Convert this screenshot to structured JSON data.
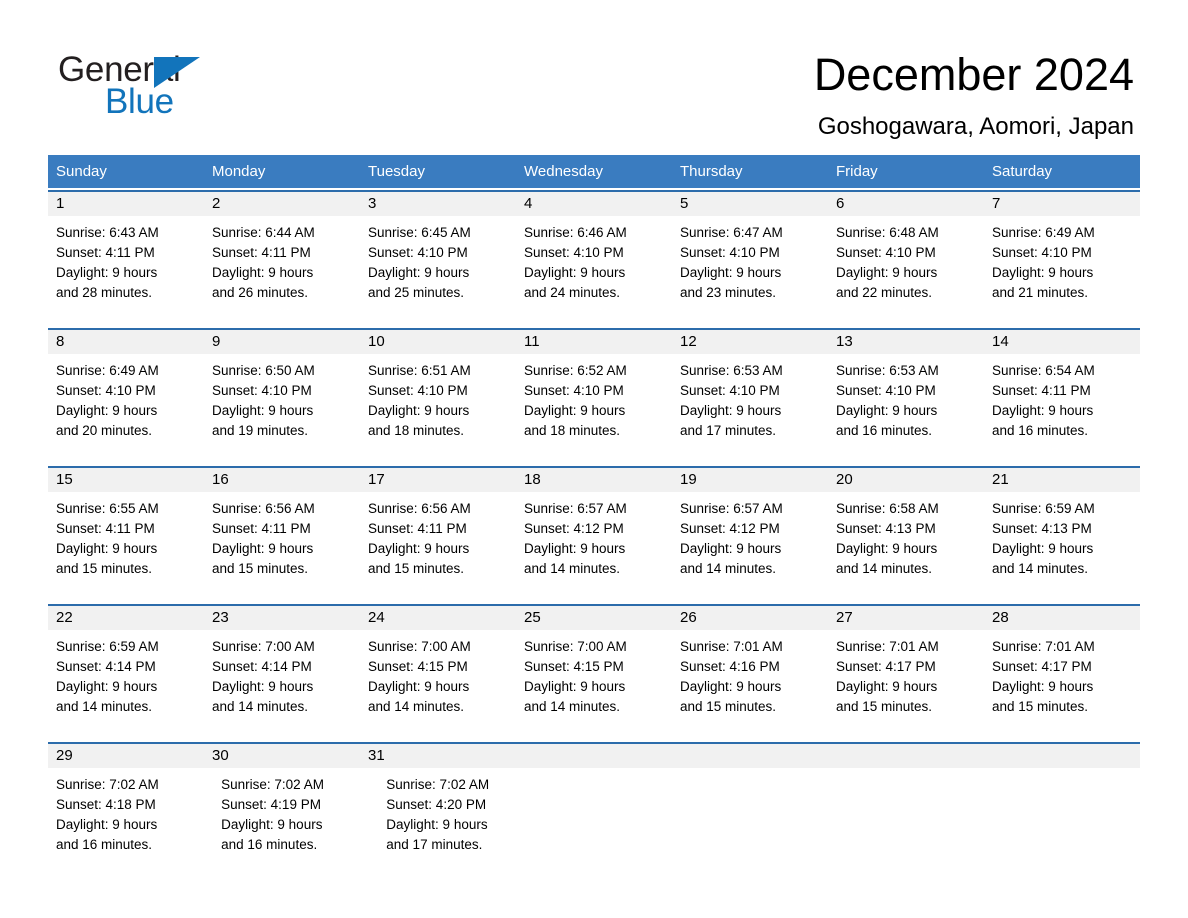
{
  "brand": {
    "name_part1": "General",
    "name_part2": "Blue",
    "triangle_color": "#1274bb",
    "text_color": "#231f20"
  },
  "header": {
    "title": "December 2024",
    "location": "Goshogawara, Aomori, Japan",
    "accent_color": "#3a7cc0",
    "rule_color": "#2c6cab",
    "daynum_bg": "#f1f1f1"
  },
  "weekdays": [
    "Sunday",
    "Monday",
    "Tuesday",
    "Wednesday",
    "Thursday",
    "Friday",
    "Saturday"
  ],
  "weeks": [
    {
      "days": [
        {
          "num": "1",
          "sunrise": "Sunrise: 6:43 AM",
          "sunset": "Sunset: 4:11 PM",
          "daylight_line1": "Daylight: 9 hours",
          "daylight_line2": "and 28 minutes."
        },
        {
          "num": "2",
          "sunrise": "Sunrise: 6:44 AM",
          "sunset": "Sunset: 4:11 PM",
          "daylight_line1": "Daylight: 9 hours",
          "daylight_line2": "and 26 minutes."
        },
        {
          "num": "3",
          "sunrise": "Sunrise: 6:45 AM",
          "sunset": "Sunset: 4:10 PM",
          "daylight_line1": "Daylight: 9 hours",
          "daylight_line2": "and 25 minutes."
        },
        {
          "num": "4",
          "sunrise": "Sunrise: 6:46 AM",
          "sunset": "Sunset: 4:10 PM",
          "daylight_line1": "Daylight: 9 hours",
          "daylight_line2": "and 24 minutes."
        },
        {
          "num": "5",
          "sunrise": "Sunrise: 6:47 AM",
          "sunset": "Sunset: 4:10 PM",
          "daylight_line1": "Daylight: 9 hours",
          "daylight_line2": "and 23 minutes."
        },
        {
          "num": "6",
          "sunrise": "Sunrise: 6:48 AM",
          "sunset": "Sunset: 4:10 PM",
          "daylight_line1": "Daylight: 9 hours",
          "daylight_line2": "and 22 minutes."
        },
        {
          "num": "7",
          "sunrise": "Sunrise: 6:49 AM",
          "sunset": "Sunset: 4:10 PM",
          "daylight_line1": "Daylight: 9 hours",
          "daylight_line2": "and 21 minutes."
        }
      ]
    },
    {
      "days": [
        {
          "num": "8",
          "sunrise": "Sunrise: 6:49 AM",
          "sunset": "Sunset: 4:10 PM",
          "daylight_line1": "Daylight: 9 hours",
          "daylight_line2": "and 20 minutes."
        },
        {
          "num": "9",
          "sunrise": "Sunrise: 6:50 AM",
          "sunset": "Sunset: 4:10 PM",
          "daylight_line1": "Daylight: 9 hours",
          "daylight_line2": "and 19 minutes."
        },
        {
          "num": "10",
          "sunrise": "Sunrise: 6:51 AM",
          "sunset": "Sunset: 4:10 PM",
          "daylight_line1": "Daylight: 9 hours",
          "daylight_line2": "and 18 minutes."
        },
        {
          "num": "11",
          "sunrise": "Sunrise: 6:52 AM",
          "sunset": "Sunset: 4:10 PM",
          "daylight_line1": "Daylight: 9 hours",
          "daylight_line2": "and 18 minutes."
        },
        {
          "num": "12",
          "sunrise": "Sunrise: 6:53 AM",
          "sunset": "Sunset: 4:10 PM",
          "daylight_line1": "Daylight: 9 hours",
          "daylight_line2": "and 17 minutes."
        },
        {
          "num": "13",
          "sunrise": "Sunrise: 6:53 AM",
          "sunset": "Sunset: 4:10 PM",
          "daylight_line1": "Daylight: 9 hours",
          "daylight_line2": "and 16 minutes."
        },
        {
          "num": "14",
          "sunrise": "Sunrise: 6:54 AM",
          "sunset": "Sunset: 4:11 PM",
          "daylight_line1": "Daylight: 9 hours",
          "daylight_line2": "and 16 minutes."
        }
      ]
    },
    {
      "days": [
        {
          "num": "15",
          "sunrise": "Sunrise: 6:55 AM",
          "sunset": "Sunset: 4:11 PM",
          "daylight_line1": "Daylight: 9 hours",
          "daylight_line2": "and 15 minutes."
        },
        {
          "num": "16",
          "sunrise": "Sunrise: 6:56 AM",
          "sunset": "Sunset: 4:11 PM",
          "daylight_line1": "Daylight: 9 hours",
          "daylight_line2": "and 15 minutes."
        },
        {
          "num": "17",
          "sunrise": "Sunrise: 6:56 AM",
          "sunset": "Sunset: 4:11 PM",
          "daylight_line1": "Daylight: 9 hours",
          "daylight_line2": "and 15 minutes."
        },
        {
          "num": "18",
          "sunrise": "Sunrise: 6:57 AM",
          "sunset": "Sunset: 4:12 PM",
          "daylight_line1": "Daylight: 9 hours",
          "daylight_line2": "and 14 minutes."
        },
        {
          "num": "19",
          "sunrise": "Sunrise: 6:57 AM",
          "sunset": "Sunset: 4:12 PM",
          "daylight_line1": "Daylight: 9 hours",
          "daylight_line2": "and 14 minutes."
        },
        {
          "num": "20",
          "sunrise": "Sunrise: 6:58 AM",
          "sunset": "Sunset: 4:13 PM",
          "daylight_line1": "Daylight: 9 hours",
          "daylight_line2": "and 14 minutes."
        },
        {
          "num": "21",
          "sunrise": "Sunrise: 6:59 AM",
          "sunset": "Sunset: 4:13 PM",
          "daylight_line1": "Daylight: 9 hours",
          "daylight_line2": "and 14 minutes."
        }
      ]
    },
    {
      "days": [
        {
          "num": "22",
          "sunrise": "Sunrise: 6:59 AM",
          "sunset": "Sunset: 4:14 PM",
          "daylight_line1": "Daylight: 9 hours",
          "daylight_line2": "and 14 minutes."
        },
        {
          "num": "23",
          "sunrise": "Sunrise: 7:00 AM",
          "sunset": "Sunset: 4:14 PM",
          "daylight_line1": "Daylight: 9 hours",
          "daylight_line2": "and 14 minutes."
        },
        {
          "num": "24",
          "sunrise": "Sunrise: 7:00 AM",
          "sunset": "Sunset: 4:15 PM",
          "daylight_line1": "Daylight: 9 hours",
          "daylight_line2": "and 14 minutes."
        },
        {
          "num": "25",
          "sunrise": "Sunrise: 7:00 AM",
          "sunset": "Sunset: 4:15 PM",
          "daylight_line1": "Daylight: 9 hours",
          "daylight_line2": "and 14 minutes."
        },
        {
          "num": "26",
          "sunrise": "Sunrise: 7:01 AM",
          "sunset": "Sunset: 4:16 PM",
          "daylight_line1": "Daylight: 9 hours",
          "daylight_line2": "and 15 minutes."
        },
        {
          "num": "27",
          "sunrise": "Sunrise: 7:01 AM",
          "sunset": "Sunset: 4:17 PM",
          "daylight_line1": "Daylight: 9 hours",
          "daylight_line2": "and 15 minutes."
        },
        {
          "num": "28",
          "sunrise": "Sunrise: 7:01 AM",
          "sunset": "Sunset: 4:17 PM",
          "daylight_line1": "Daylight: 9 hours",
          "daylight_line2": "and 15 minutes."
        }
      ]
    },
    {
      "days": [
        {
          "num": "29",
          "sunrise": "Sunrise: 7:02 AM",
          "sunset": "Sunset: 4:18 PM",
          "daylight_line1": "Daylight: 9 hours",
          "daylight_line2": "and 16 minutes."
        },
        {
          "num": "30",
          "sunrise": "Sunrise: 7:02 AM",
          "sunset": "Sunset: 4:19 PM",
          "daylight_line1": "Daylight: 9 hours",
          "daylight_line2": "and 16 minutes."
        },
        {
          "num": "31",
          "sunrise": "Sunrise: 7:02 AM",
          "sunset": "Sunset: 4:20 PM",
          "daylight_line1": "Daylight: 9 hours",
          "daylight_line2": "and 17 minutes."
        },
        {
          "num": "",
          "sunrise": "",
          "sunset": "",
          "daylight_line1": "",
          "daylight_line2": ""
        },
        {
          "num": "",
          "sunrise": "",
          "sunset": "",
          "daylight_line1": "",
          "daylight_line2": ""
        },
        {
          "num": "",
          "sunrise": "",
          "sunset": "",
          "daylight_line1": "",
          "daylight_line2": ""
        },
        {
          "num": "",
          "sunrise": "",
          "sunset": "",
          "daylight_line1": "",
          "daylight_line2": ""
        }
      ]
    }
  ]
}
